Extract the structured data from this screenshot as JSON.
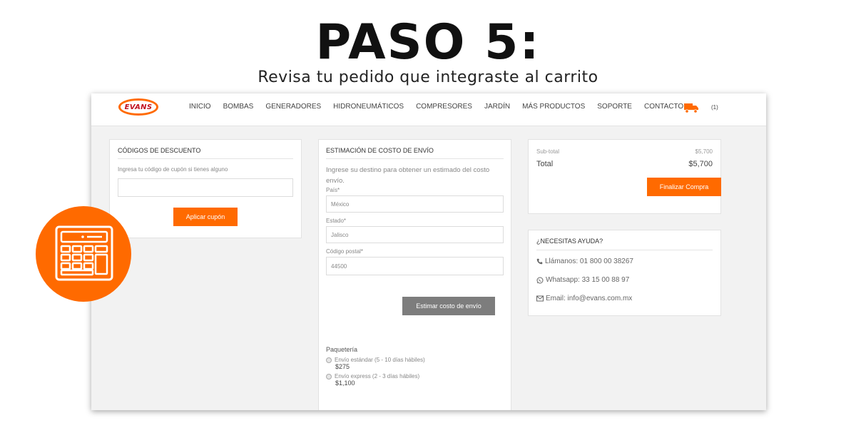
{
  "heading": {
    "title": "PASO 5:",
    "subtitle": "Revisa tu pedido que integraste al carrito"
  },
  "nav": {
    "logo_text": "EVANS",
    "items": [
      "INICIO",
      "BOMBAS",
      "GENERADORES",
      "HIDRONEUMÁTICOS",
      "COMPRESORES",
      "JARDÍN",
      "MÁS PRODUCTOS",
      "SOPORTE",
      "CONTACTO"
    ],
    "cart_icon": "truck-icon",
    "cart_count": "(1)"
  },
  "discount": {
    "title": "CÓDIGOS DE DESCUENTO",
    "hint": "Ingresa tu código de cupón si tienes alguno",
    "input_value": "",
    "button": "Aplicar cupón"
  },
  "shipping": {
    "title": "ESTIMACIÓN DE COSTO DE ENVÍO",
    "description": "Ingrese su destino para obtener un estimado del costo envío.",
    "country_label": "País*",
    "country_value": "México",
    "state_label": "Estado*",
    "state_value": "Jalisco",
    "zip_label": "Código postal*",
    "zip_value": "44500",
    "button": "Estimar costo de envío",
    "carrier_label": "Paquetería",
    "options": [
      {
        "label": "Envío estándar (5 - 10 días hábiles)",
        "price": "$275"
      },
      {
        "label": "Envío express (2 - 3 días hábiles)",
        "price": "$1,100"
      }
    ]
  },
  "summary": {
    "subtotal_label": "Sub-total",
    "subtotal_value": "$5,700",
    "total_label": "Total",
    "total_value": "$5,700",
    "button": "Finalizar Compra"
  },
  "help": {
    "title": "¿NECESITAS AYUDA?",
    "phone": "Llámanos: 01 800 00 38267",
    "whatsapp": "Whatsapp: 33 15 00 88 97",
    "email": "Email: info@evans.com.mx"
  },
  "colors": {
    "accent": "#ff6a00",
    "button_gray": "#7d7d7d",
    "background": "#f2f2f2"
  },
  "badge_icon": "calculator-icon"
}
